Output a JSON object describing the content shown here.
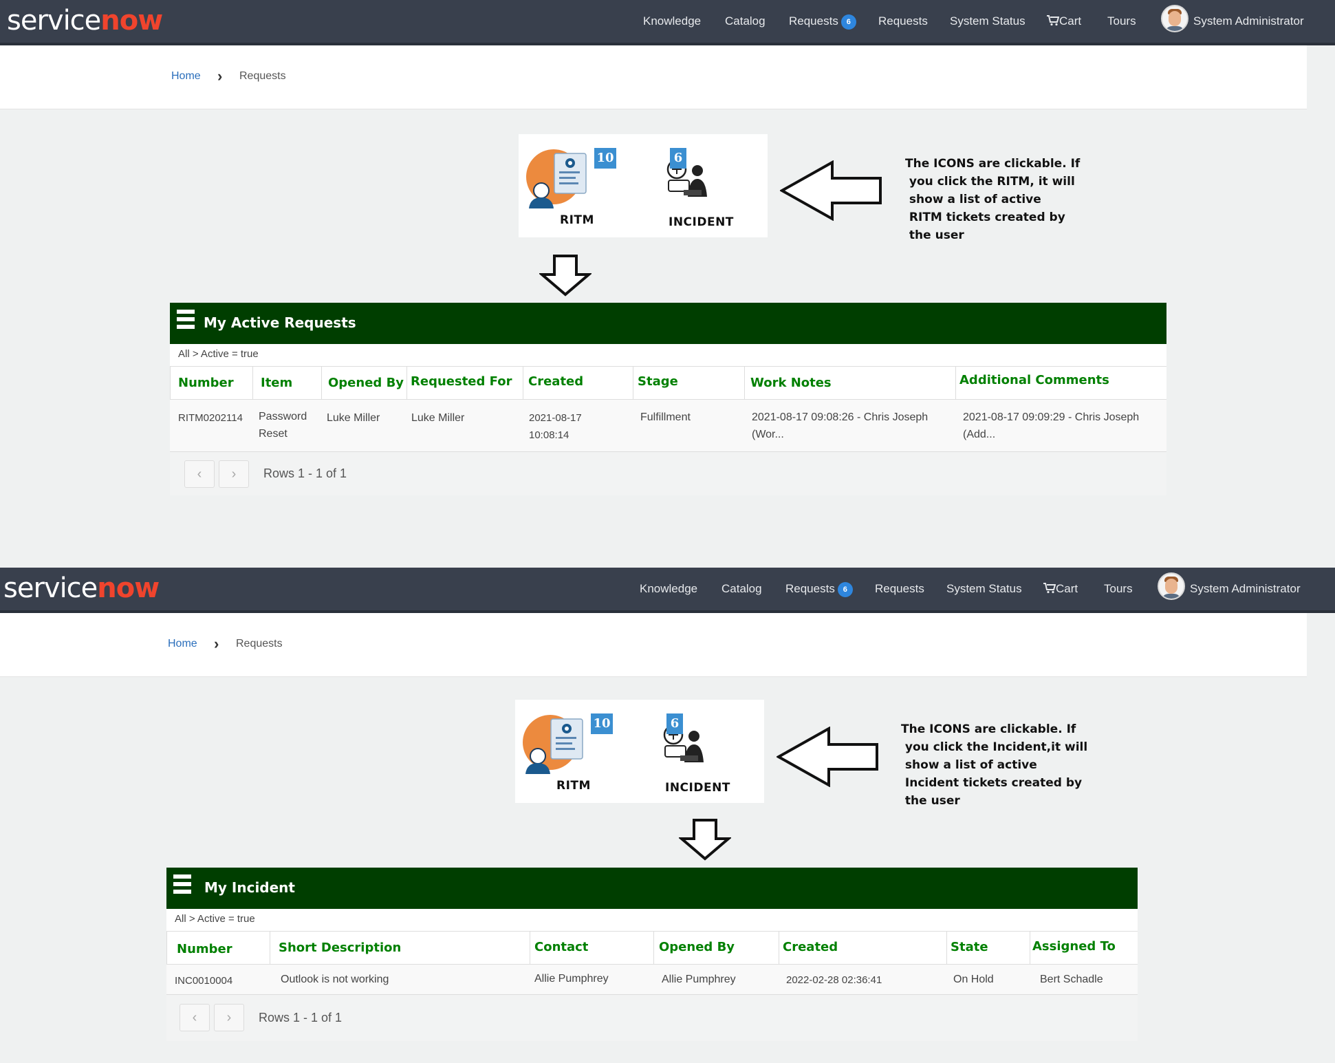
{
  "brand": {
    "service": "service",
    "now": "now"
  },
  "nav": {
    "knowledge": "Knowledge",
    "catalog": "Catalog",
    "requests_badge_label": "Requests",
    "requests_badge_count": "6",
    "requests": "Requests",
    "system_status": "System Status",
    "cart": "Cart",
    "tours": "Tours",
    "user": "System Administrator"
  },
  "breadcrumb": {
    "home": "Home",
    "current": "Requests"
  },
  "icons": {
    "ritm": {
      "label": "RITM",
      "count": "10"
    },
    "incident": {
      "label": "INCIDENT",
      "count": "6"
    }
  },
  "notes": {
    "top": "The ICONS are clickable. If\n you click the RITM, it will\n show a list of active\n RITM tickets created by\n the user",
    "bottom": "The ICONS are clickable. If\n you click the Incident,it will\n show a list of active\n Incident tickets created by\n the user"
  },
  "requests_list": {
    "title": "My Active Requests",
    "filter": "All > Active = true",
    "columns": [
      "Number",
      "Item",
      "Opened By",
      "Requested For",
      "Created",
      "Stage",
      "Work Notes",
      "Additional Comments"
    ],
    "rows": [
      {
        "number": "RITM0202114",
        "item_line1": "Password",
        "item_line2": "Reset",
        "opened_by": "Luke Miller",
        "requested_for": "Luke Miller",
        "created_line1": "2021-08-17",
        "created_line2": "10:08:14",
        "stage": "Fulfillment",
        "work_notes_line1": "2021-08-17 09:08:26 - Chris Joseph",
        "work_notes_line2": "(Wor...",
        "comments_line1": "2021-08-17 09:09:29 - Chris Joseph",
        "comments_line2": "(Add..."
      }
    ],
    "rows_text": "Rows 1 - 1 of 1"
  },
  "incident_list": {
    "title": "My Incident",
    "filter": "All > Active = true",
    "columns": [
      "Number",
      "Short Description",
      "Contact",
      "Opened By",
      "Created",
      "State",
      "Assigned To"
    ],
    "rows": [
      {
        "number": "INC0010004",
        "short_description": "Outlook is not working",
        "contact": "Allie Pumphrey",
        "opened_by": "Allie Pumphrey",
        "created": "2022-02-28 02:36:41",
        "state": "On Hold",
        "assigned_to": "Bert Schadle"
      }
    ],
    "rows_text": "Rows 1 - 1 of 1"
  },
  "colors": {
    "navbar": "#39404d",
    "list_header": "#003e00",
    "column_header_text": "#008000",
    "badge": "#2e86de",
    "count_badge": "#3b8fd1",
    "link": "#2a6ebb",
    "logo_now": "#f0442d"
  },
  "icon_names": {
    "ritm": "ritm-request-icon",
    "incident": "incident-support-icon",
    "cart": "cart-icon",
    "left_arrow": "left-arrow-icon",
    "down_arrow": "down-arrow-icon"
  }
}
